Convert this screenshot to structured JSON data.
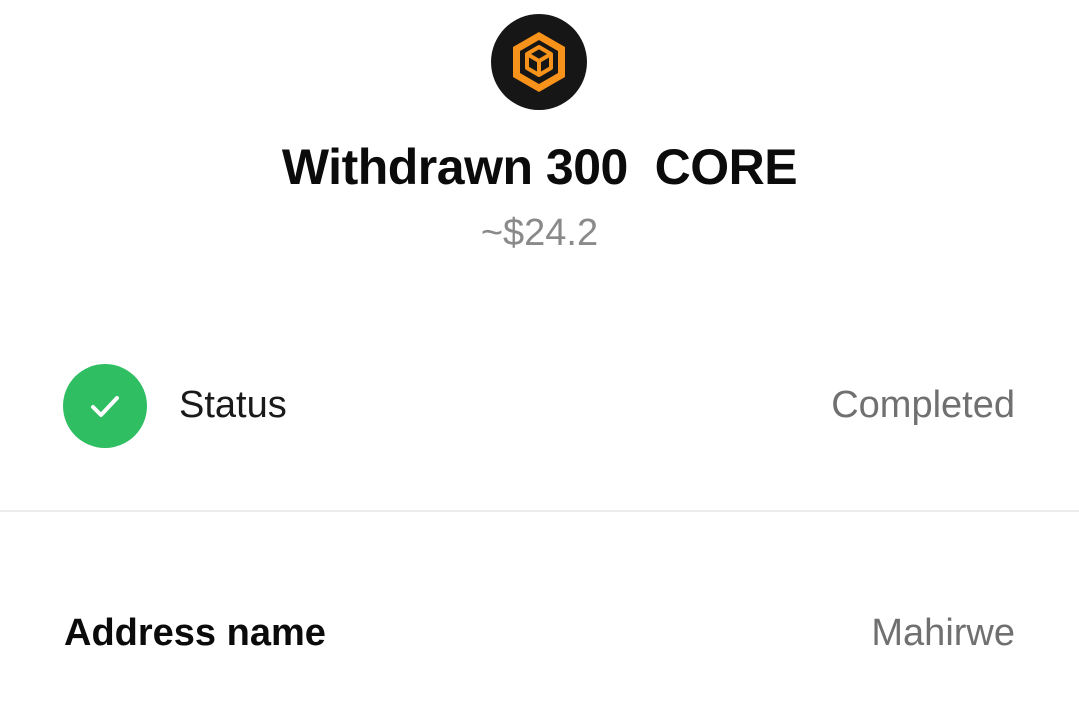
{
  "header": {
    "token_icon": "core-token-icon",
    "title": "Withdrawn 300  CORE",
    "fiat_value": "~$24.2"
  },
  "details": {
    "status": {
      "icon": "check-circle-icon",
      "label": "Status",
      "value": "Completed"
    },
    "address_name": {
      "label": "Address name",
      "value": "Mahirwe"
    }
  },
  "colors": {
    "accent_orange": "#F7931A",
    "logo_bg": "#161616",
    "success_green": "#2FBE61",
    "muted_text": "#707070"
  }
}
